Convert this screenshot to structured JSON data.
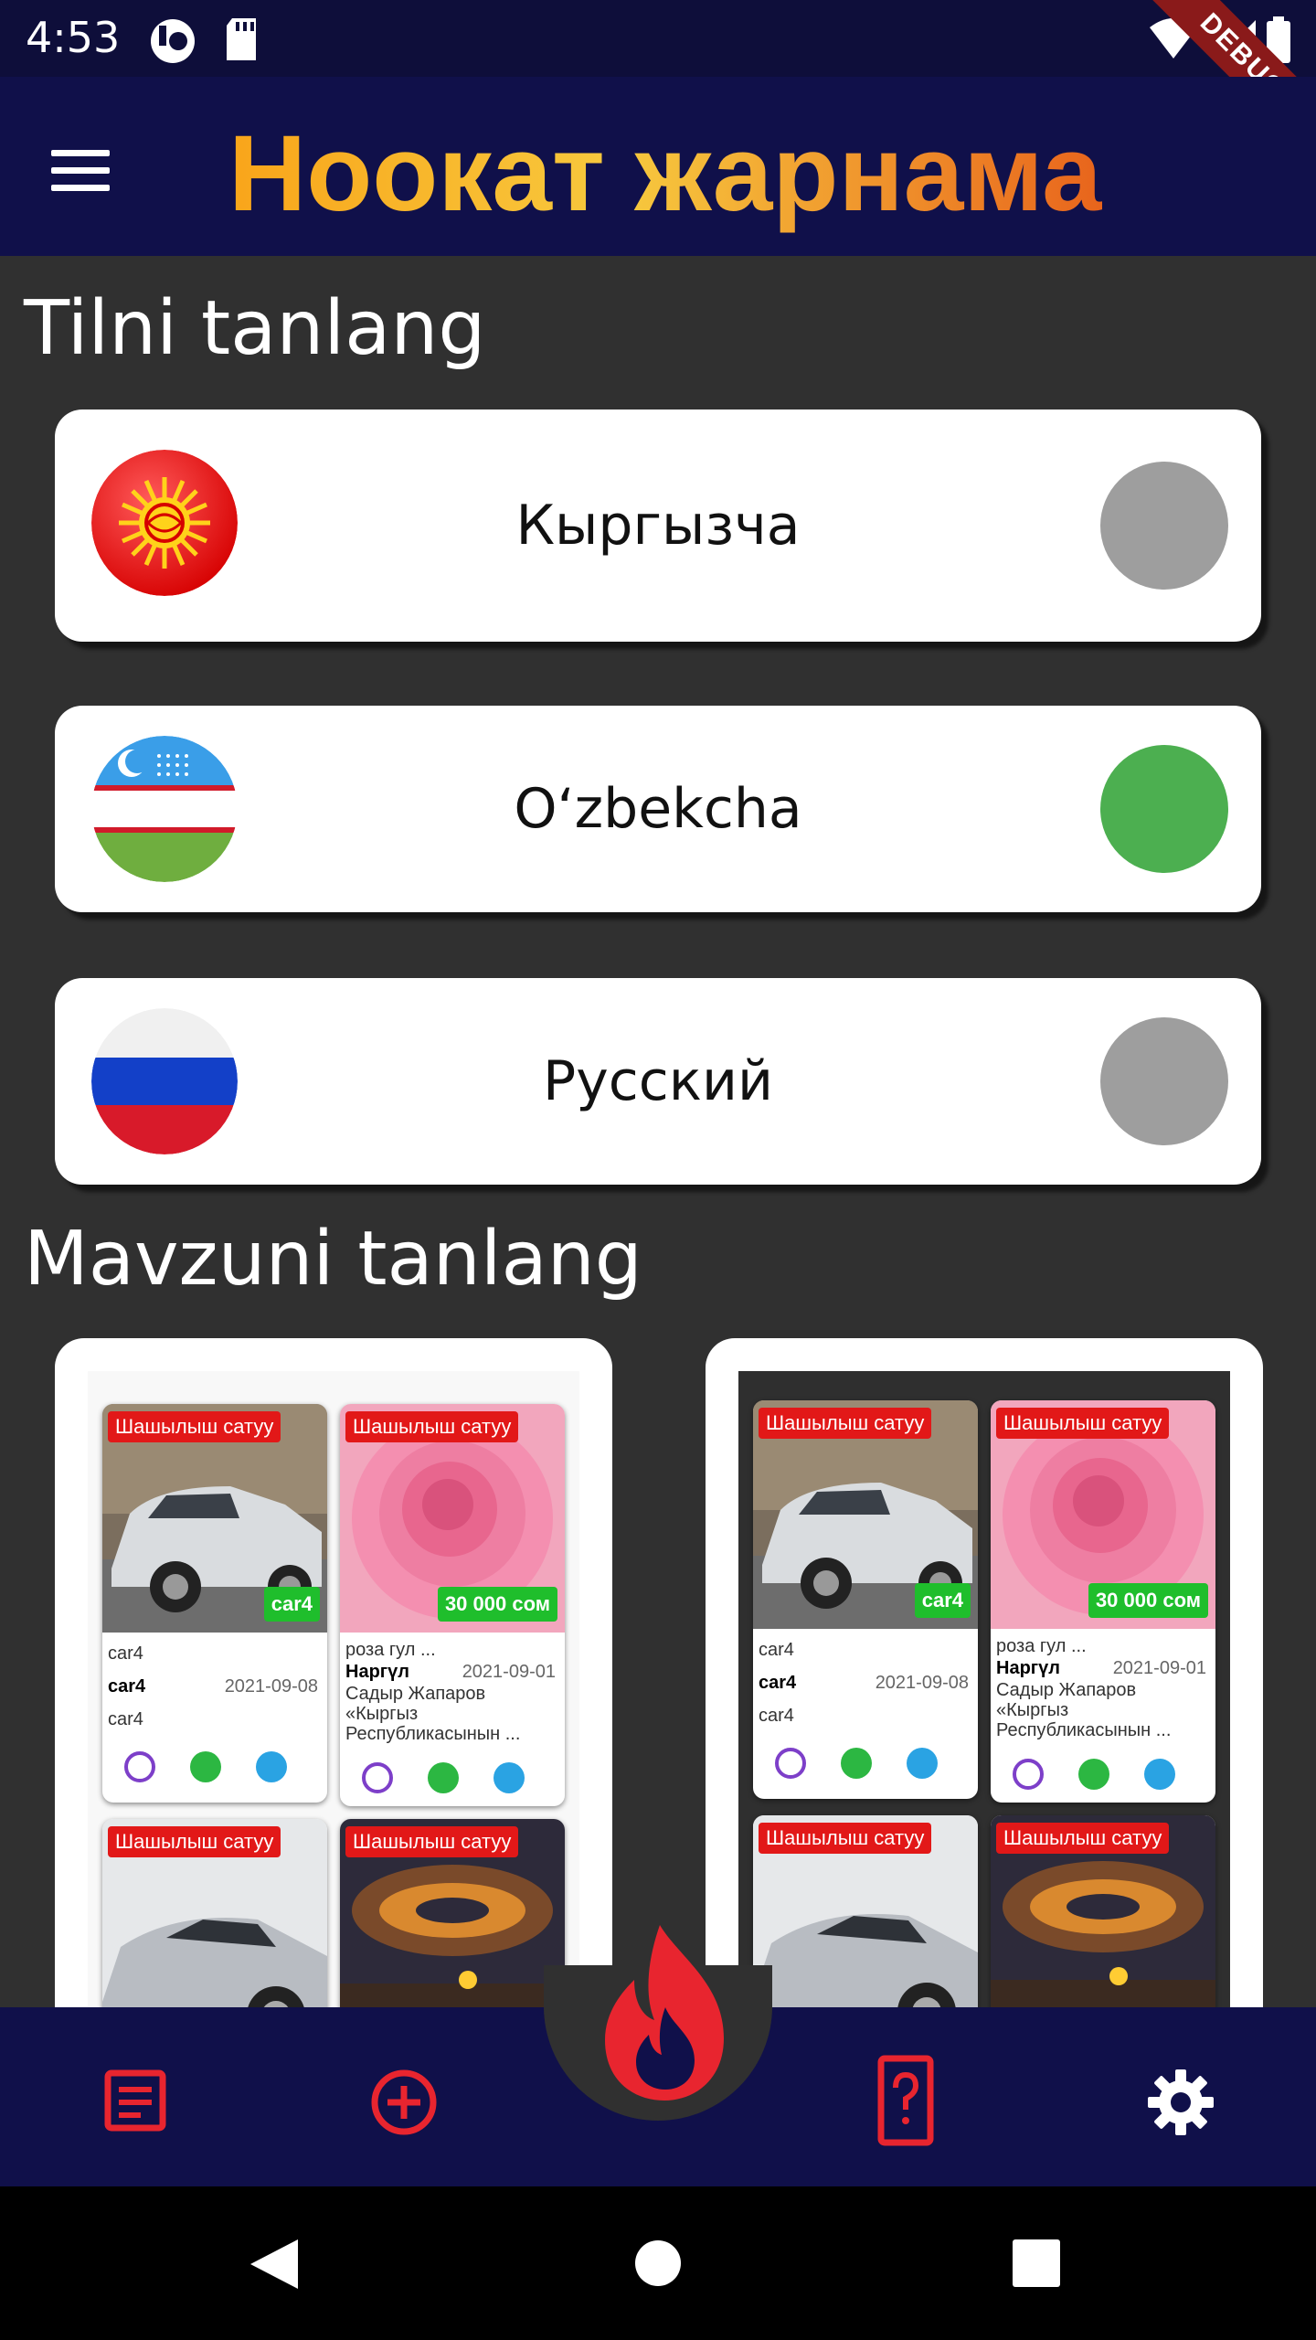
{
  "status_bar": {
    "time": "4:53",
    "debug_label": "DEBUG"
  },
  "app_bar": {
    "title": "Ноокат жарнама"
  },
  "language_section": {
    "title": "Tilni tanlang",
    "options": [
      {
        "label": "Кыргызча",
        "selected": false,
        "flag": "kyrgyzstan-flag"
      },
      {
        "label": "Oʻzbekcha",
        "selected": true,
        "flag": "uzbekistan-flag"
      },
      {
        "label": "Русский",
        "selected": false,
        "flag": "russia-flag"
      }
    ]
  },
  "theme_section": {
    "title": "Mavzuni tanlang",
    "preview": {
      "tiles": [
        {
          "badge": "Шашылыш сатуу",
          "price": "car4",
          "name": "car4",
          "title": "car4",
          "date": "2021-09-08",
          "desc": "car4"
        },
        {
          "badge": "Шашылыш сатуу",
          "price": "30 000 сом",
          "name": "роза гул ...",
          "title": "Наргүл",
          "date": "2021-09-01",
          "desc": "Садыр Жапаров «Кыргыз Республикасынын ..."
        },
        {
          "badge": "Шашылыш сатуу"
        },
        {
          "badge": "Шашылыш сатуу"
        }
      ]
    }
  },
  "bottom_nav": {
    "items": [
      "list-icon",
      "add-circle-icon",
      "flame-icon",
      "help-icon",
      "settings-icon"
    ]
  },
  "colors": {
    "accent_red": "#e8252f",
    "selected_green": "#4caf50",
    "unselected_grey": "#9e9e9e",
    "bar_navy": "#10104a"
  }
}
